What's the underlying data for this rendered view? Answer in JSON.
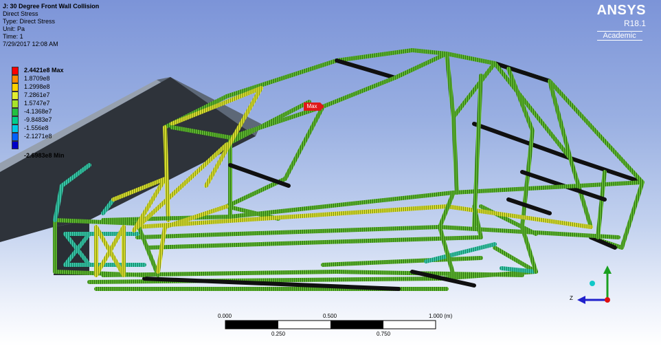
{
  "info": {
    "title": "J: 30 Degree Front Wall Collision",
    "line1": "Direct Stress",
    "line2": "Type: Direct Stress",
    "line3": "Unit: Pa",
    "line4": "Time: 1",
    "line5": "7/29/2017 12:08 AM"
  },
  "legend": {
    "items": [
      {
        "label": "2.4421e8 Max",
        "color": "#ff0000"
      },
      {
        "label": "1.8709e8",
        "color": "#ff8c00"
      },
      {
        "label": "1.2998e8",
        "color": "#ffd200"
      },
      {
        "label": "7.2861e7",
        "color": "#e1ee30"
      },
      {
        "label": "1.5747e7",
        "color": "#a8e42a"
      },
      {
        "label": "-4.1368e7",
        "color": "#22c040"
      },
      {
        "label": "-9.8483e7",
        "color": "#00ce8c"
      },
      {
        "label": "-1.556e8",
        "color": "#00c8e6"
      },
      {
        "label": "-2.1271e8",
        "color": "#0060ff"
      },
      {
        "label": "-2.6983e8 Min",
        "color": "#0000c8"
      }
    ]
  },
  "brand": {
    "name": "ANSYS",
    "version": "R18.1",
    "license": "Academic"
  },
  "probe": {
    "max_label": "Max"
  },
  "scale": {
    "ticks_top": [
      "0.000",
      "0.500",
      "1.000 (m)"
    ],
    "ticks_bottom": [
      "0.250",
      "0.750"
    ]
  },
  "triad": {
    "z_label": "Z",
    "icons": [
      "axis-triad-icon",
      "isometric-ball-icon"
    ]
  },
  "colors": {
    "frame_green": "#3f8f18",
    "frame_yellow": "#c8c81e",
    "wall_dark": "#2f343b",
    "wall_top": "#6b7584",
    "black_member": "#101010",
    "max_tag": "#e01818"
  }
}
